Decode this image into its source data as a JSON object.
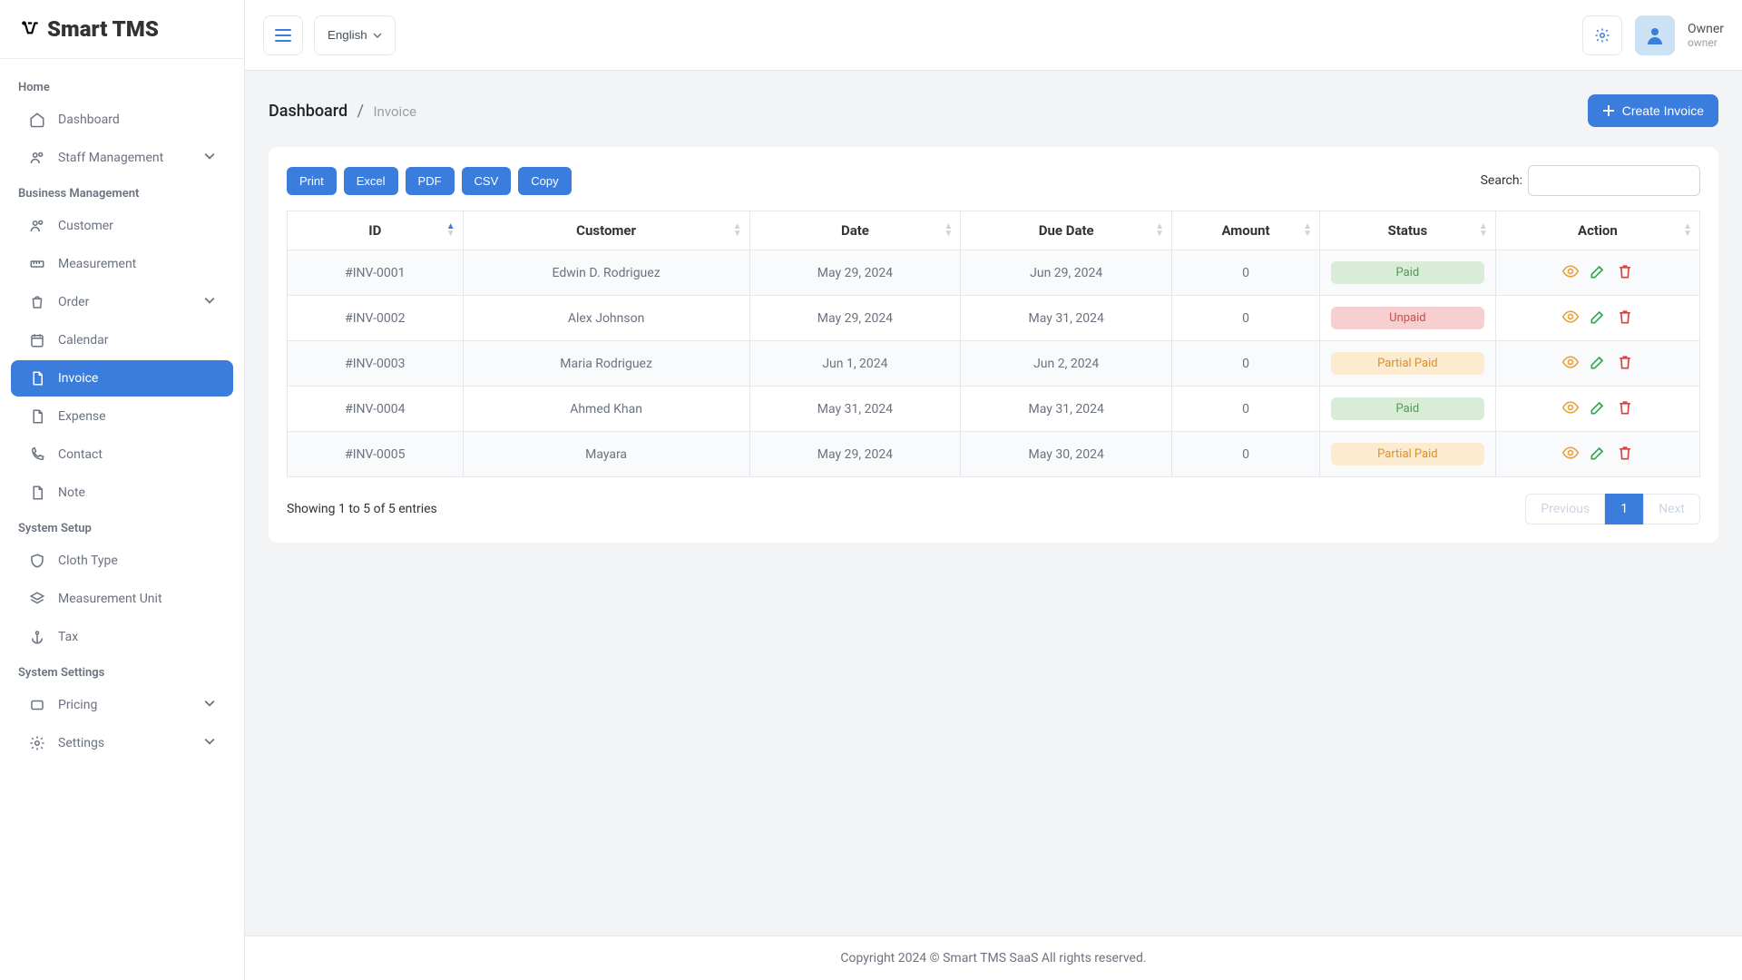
{
  "logo": "Smart TMS",
  "topbar": {
    "language": "English",
    "user_name": "Owner",
    "user_role": "owner"
  },
  "sidebar": {
    "sections": [
      {
        "title": "Home",
        "items": [
          "Dashboard",
          "Staff Management"
        ]
      },
      {
        "title": "Business Management",
        "items": [
          "Customer",
          "Measurement",
          "Order",
          "Calendar",
          "Invoice",
          "Expense",
          "Contact",
          "Note"
        ]
      },
      {
        "title": "System Setup",
        "items": [
          "Cloth Type",
          "Measurement Unit",
          "Tax"
        ]
      },
      {
        "title": "System Settings",
        "items": [
          "Pricing",
          "Settings"
        ]
      }
    ],
    "active": "Invoice"
  },
  "breadcrumb": {
    "root": "Dashboard",
    "leaf": "Invoice"
  },
  "buttons": {
    "create": "Create Invoice",
    "print": "Print",
    "excel": "Excel",
    "pdf": "PDF",
    "csv": "CSV",
    "copy": "Copy",
    "search_label": "Search:",
    "previous": "Previous",
    "next": "Next",
    "page": "1"
  },
  "table": {
    "columns": [
      "ID",
      "Customer",
      "Date",
      "Due Date",
      "Amount",
      "Status",
      "Action"
    ],
    "rows": [
      {
        "id": "#INV-0001",
        "customer": "Edwin D. Rodriguez",
        "date": "May 29, 2024",
        "due": "Jun 29, 2024",
        "amount": "0",
        "status": "Paid"
      },
      {
        "id": "#INV-0002",
        "customer": "Alex Johnson",
        "date": "May 29, 2024",
        "due": "May 31, 2024",
        "amount": "0",
        "status": "Unpaid"
      },
      {
        "id": "#INV-0003",
        "customer": "Maria Rodriguez",
        "date": "Jun 1, 2024",
        "due": "Jun 2, 2024",
        "amount": "0",
        "status": "Partial Paid"
      },
      {
        "id": "#INV-0004",
        "customer": "Ahmed Khan",
        "date": "May 31, 2024",
        "due": "May 31, 2024",
        "amount": "0",
        "status": "Paid"
      },
      {
        "id": "#INV-0005",
        "customer": "Mayara",
        "date": "May 29, 2024",
        "due": "May 30, 2024",
        "amount": "0",
        "status": "Partial Paid"
      }
    ],
    "info": "Showing 1 to 5 of 5 entries"
  },
  "footer": "Copyright 2024 © Smart TMS SaaS All rights reserved.",
  "status_class": {
    "Paid": "paid",
    "Unpaid": "unpaid",
    "Partial Paid": "partial"
  },
  "expandable": [
    "Staff Management",
    "Order",
    "Pricing",
    "Settings"
  ],
  "nav_icons": {
    "Dashboard": "home",
    "Staff Management": "users",
    "Customer": "users",
    "Measurement": "ruler",
    "Order": "bag",
    "Calendar": "calendar",
    "Invoice": "file",
    "Expense": "file",
    "Contact": "phone",
    "Note": "file",
    "Cloth Type": "shield",
    "Measurement Unit": "layers",
    "Tax": "anchor",
    "Pricing": "tag",
    "Settings": "gear"
  }
}
